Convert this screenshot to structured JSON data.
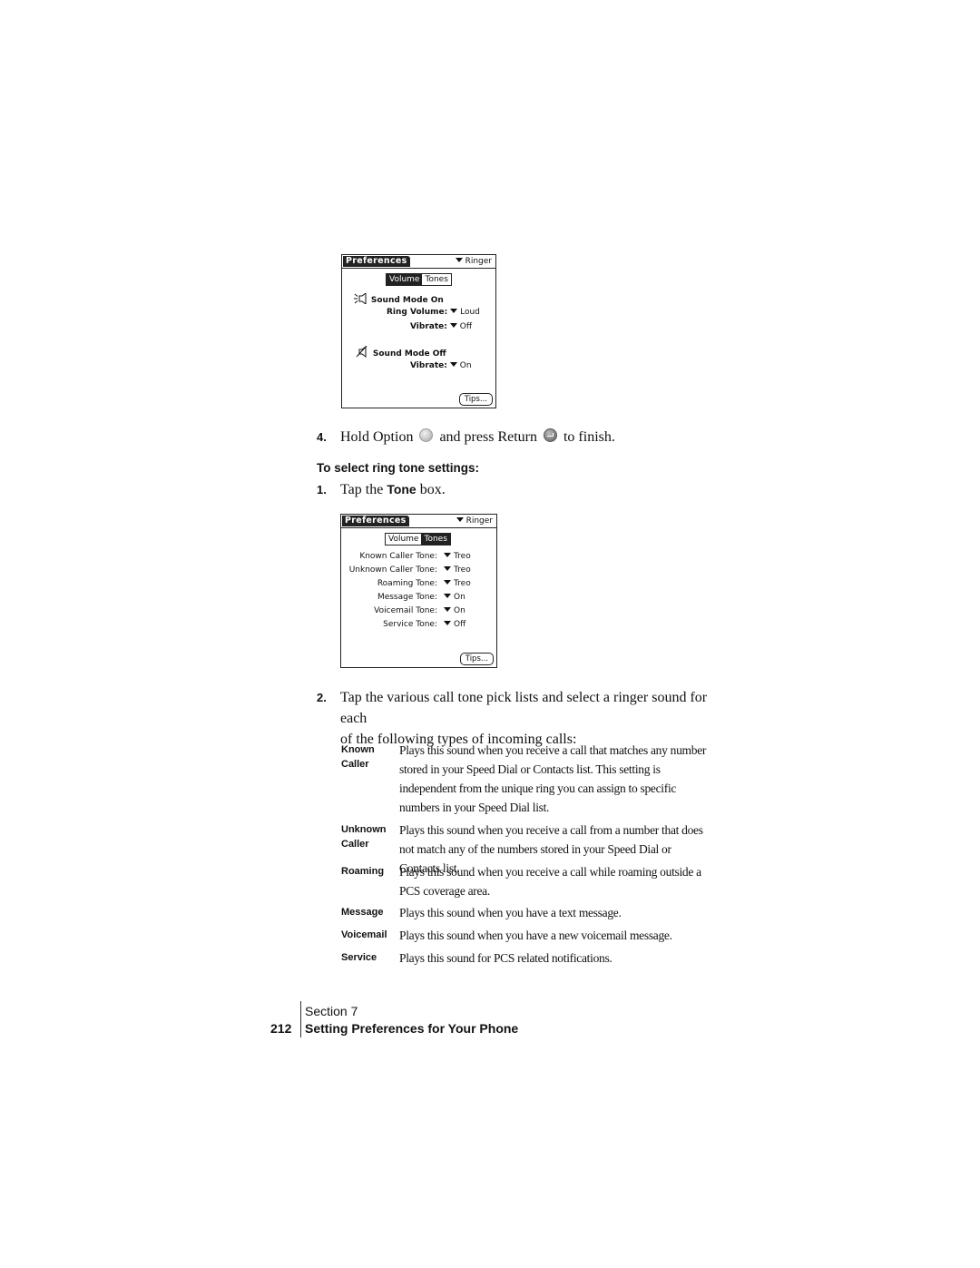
{
  "screen1": {
    "title": "Preferences",
    "category": "Ringer",
    "tabs": [
      "Volume",
      "Tones"
    ],
    "active_tab": "Volume",
    "sound_on_label": "Sound Mode On",
    "ring_volume_label": "Ring Volume:",
    "ring_volume_value": "Loud",
    "vibrate_on_label": "Vibrate:",
    "vibrate_on_value": "Off",
    "sound_off_label": "Sound Mode Off",
    "vibrate_off_label": "Vibrate:",
    "vibrate_off_value": "On",
    "tips_label": "Tips..."
  },
  "step4": {
    "number": "4.",
    "text_a": "Hold Option",
    "text_b": "and press Return",
    "text_c": "to finish.",
    "icons": [
      "option-key-icon",
      "return-key-icon"
    ]
  },
  "section_heading": "To select ring tone settings:",
  "step1": {
    "number": "1.",
    "text_a": "Tap the",
    "bold": "Tone",
    "text_b": "box."
  },
  "screen2": {
    "title": "Preferences",
    "category": "Ringer",
    "tabs": [
      "Volume",
      "Tones"
    ],
    "active_tab": "Tones",
    "rows": [
      {
        "label": "Known Caller Tone:",
        "value": "Treo"
      },
      {
        "label": "Unknown Caller Tone:",
        "value": "Treo"
      },
      {
        "label": "Roaming Tone:",
        "value": "Treo"
      },
      {
        "label": "Message Tone:",
        "value": "On"
      },
      {
        "label": "Voicemail Tone:",
        "value": "On"
      },
      {
        "label": "Service Tone:",
        "value": "Off"
      }
    ],
    "tips_label": "Tips..."
  },
  "step2": {
    "number": "2.",
    "line1": "Tap the various call tone pick lists and select a ringer sound for each",
    "line2": "of the following types of incoming calls:"
  },
  "definitions": [
    {
      "term_line1": "Known",
      "term_line2": "Caller",
      "desc": "Plays this sound when you receive a call that matches any number stored in your Speed Dial or Contacts list. This setting is independent from the unique ring you can assign to specific numbers in your Speed Dial list."
    },
    {
      "term_line1": "Unknown",
      "term_line2": "Caller",
      "desc": "Plays this sound when you receive a call from a number that does not match any of the numbers stored in your Speed Dial or Contacts list."
    },
    {
      "term_line1": "Roaming",
      "term_line2": "",
      "desc": "Plays this sound when you receive a call while roaming outside a PCS coverage area."
    },
    {
      "term_line1": "Message",
      "term_line2": "",
      "desc": "Plays this sound when you have a text message."
    },
    {
      "term_line1": "Voicemail",
      "term_line2": "",
      "desc": "Plays this sound when you have a new voicemail message."
    },
    {
      "term_line1": "Service",
      "term_line2": "",
      "desc": "Plays this sound for PCS related notifications."
    }
  ],
  "footer": {
    "section": "Section 7",
    "title": "Setting Preferences for Your Phone",
    "page": "212"
  }
}
